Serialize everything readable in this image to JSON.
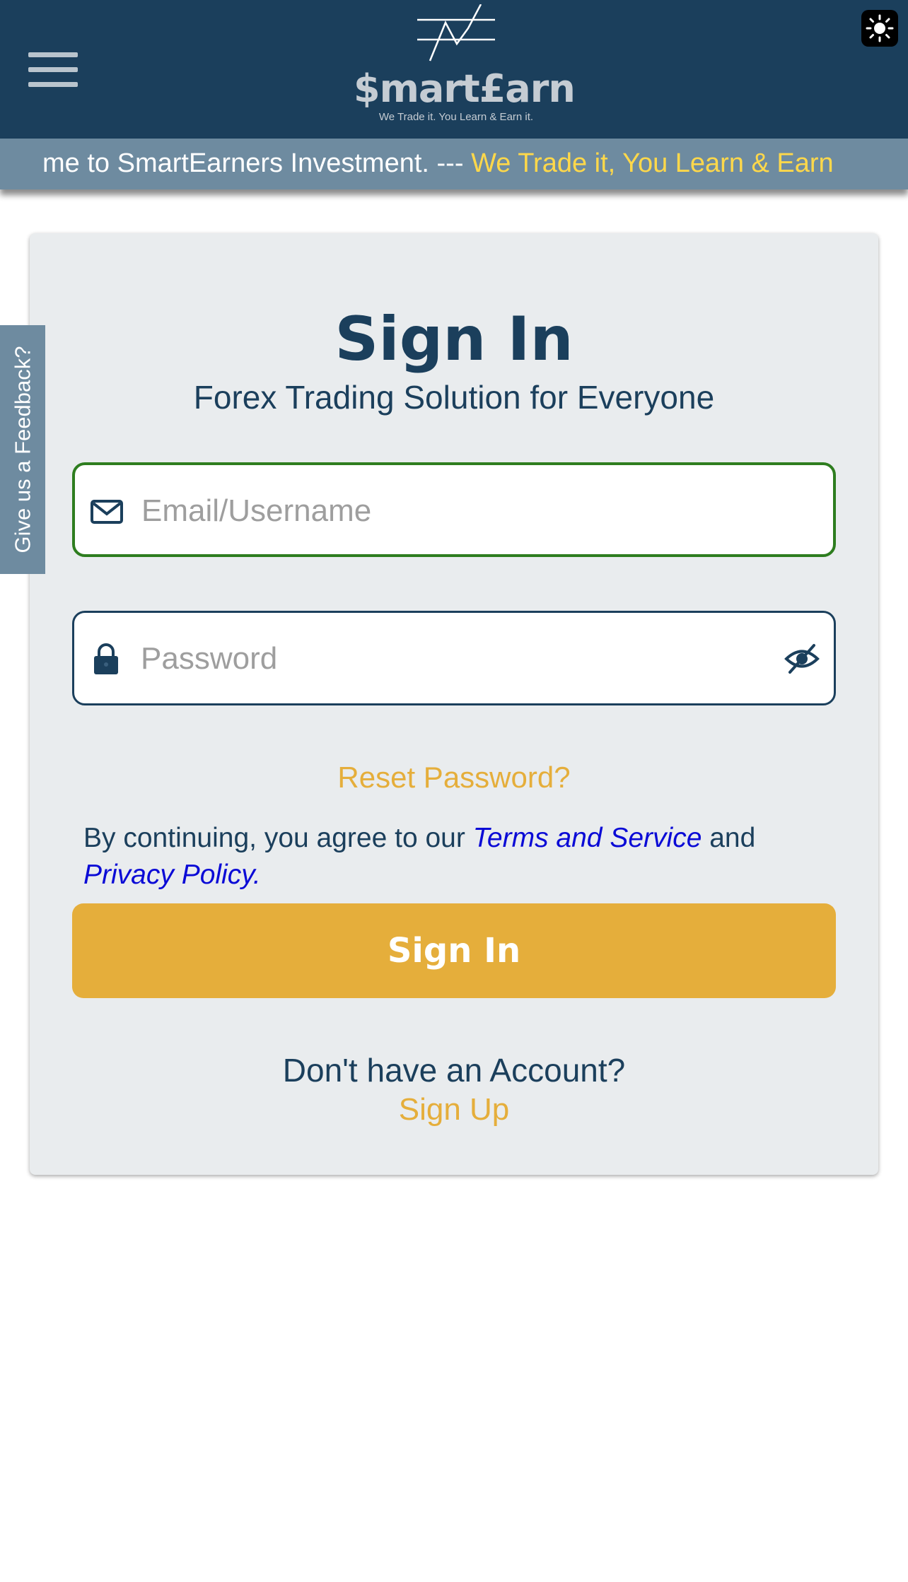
{
  "header": {
    "logo_text": "$mart£arn",
    "logo_tagline": "We Trade it. You Learn & Earn it.",
    "menu_icon": "hamburger-menu-icon",
    "theme_icon": "sun-icon"
  },
  "ticker": {
    "text_white": "me to SmartEarners Investment. --- ",
    "text_yellow": "We Trade it, You Learn & Earn"
  },
  "feedback_tab": {
    "label": "Give us a Feedback?"
  },
  "signin_form": {
    "title": "Sign In",
    "subtitle": "Forex Trading Solution for Everyone",
    "email": {
      "placeholder": "Email/Username",
      "value": "",
      "icon": "mail-icon"
    },
    "password": {
      "placeholder": "Password",
      "value": "",
      "icon": "lock-icon",
      "toggle_icon": "eye-slash-icon"
    },
    "reset_link": "Reset Password?",
    "terms": {
      "prefix": "By continuing, you agree to our ",
      "terms_link": "Terms and Service",
      "middle": " and ",
      "privacy_link": "Privacy Policy."
    },
    "submit_label": "Sign In",
    "no_account_text": "Don't have an Account?",
    "signup_link": "Sign Up"
  },
  "colors": {
    "primary": "#1b3f5c",
    "accent": "#e5ae3b",
    "ticker_bg": "#6e8ba0",
    "ticker_highlight": "#ffd84a",
    "email_focus_border": "#2e7d1f",
    "link": "#0a0ad6",
    "card_bg": "#e9ecee"
  }
}
